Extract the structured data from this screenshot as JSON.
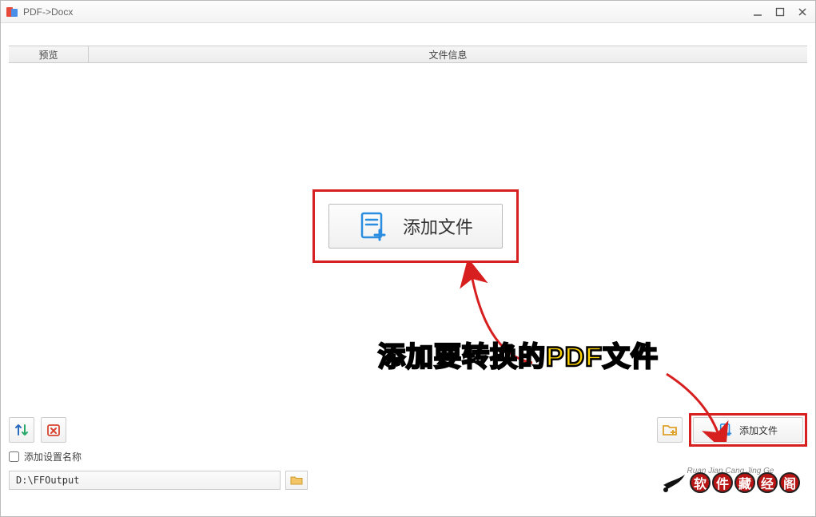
{
  "window": {
    "title": "PDF->Docx"
  },
  "tabs": {
    "left": "预览",
    "right": "文件信息"
  },
  "main": {
    "add_file_button_label": "添加文件"
  },
  "annotation": {
    "text": "添加要转换的PDF文件"
  },
  "toolbar": {
    "add_file_small_label": "添加文件"
  },
  "options": {
    "add_settings_name_label": "添加设置名称"
  },
  "output": {
    "path": "D:\\FFOutput"
  },
  "watermark": {
    "subtitle": "Ruan Jian Cang Jing Ge",
    "chars": [
      "软",
      "件",
      "藏",
      "经",
      "阁"
    ]
  }
}
